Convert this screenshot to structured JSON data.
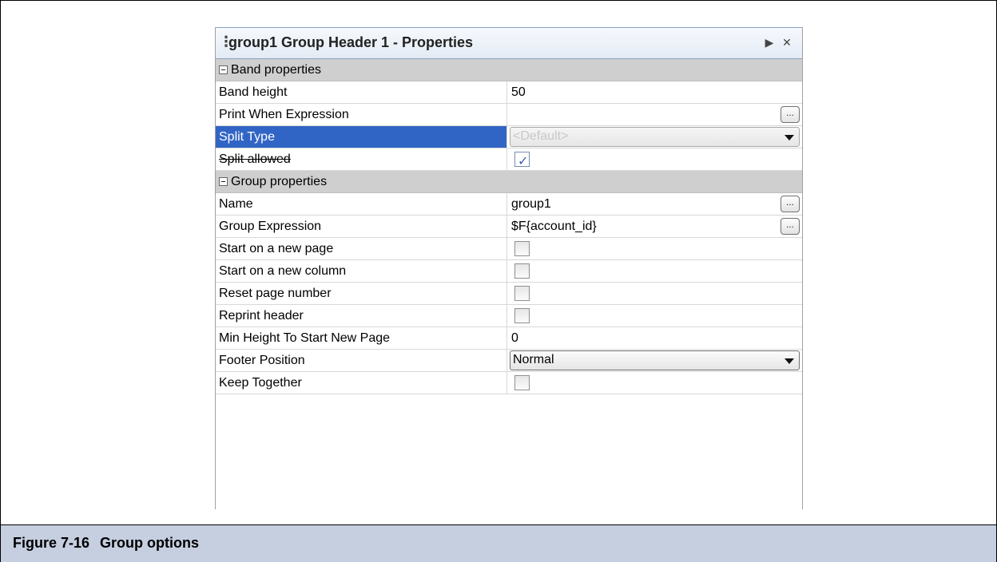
{
  "panel": {
    "title": "group1 Group Header 1 - Properties",
    "grip_icon": "grip-icon",
    "minimize_icon": "minimize-icon",
    "close_icon": "close-icon"
  },
  "categories": {
    "band": "Band properties",
    "group": "Group properties"
  },
  "properties": {
    "band_height": {
      "label": "Band height",
      "value": "50"
    },
    "print_when": {
      "label": "Print When Expression",
      "value": "",
      "button": "..."
    },
    "split_type": {
      "label": "Split Type",
      "value": "<Default>"
    },
    "split_allowed": {
      "label": "Split allowed",
      "checked": true
    },
    "name": {
      "label": "Name",
      "value": "group1",
      "button": "..."
    },
    "group_expression": {
      "label": "Group Expression",
      "value": "$F{account_id}",
      "button": "..."
    },
    "start_new_page": {
      "label": "Start on a new page",
      "checked": false
    },
    "start_new_column": {
      "label": "Start on a new column",
      "checked": false
    },
    "reset_page_number": {
      "label": "Reset page number",
      "checked": false
    },
    "reprint_header": {
      "label": "Reprint header",
      "checked": false
    },
    "min_height": {
      "label": "Min Height To Start New Page",
      "value": "0"
    },
    "footer_position": {
      "label": "Footer Position",
      "value": "Normal"
    },
    "keep_together": {
      "label": "Keep Together",
      "checked": false
    }
  },
  "caption": {
    "number": "Figure 7-16",
    "title": "Group options"
  },
  "colors": {
    "selection": "#3165c5",
    "category_bg": "#cfcfcf",
    "caption_bg": "#c5cfe0"
  }
}
